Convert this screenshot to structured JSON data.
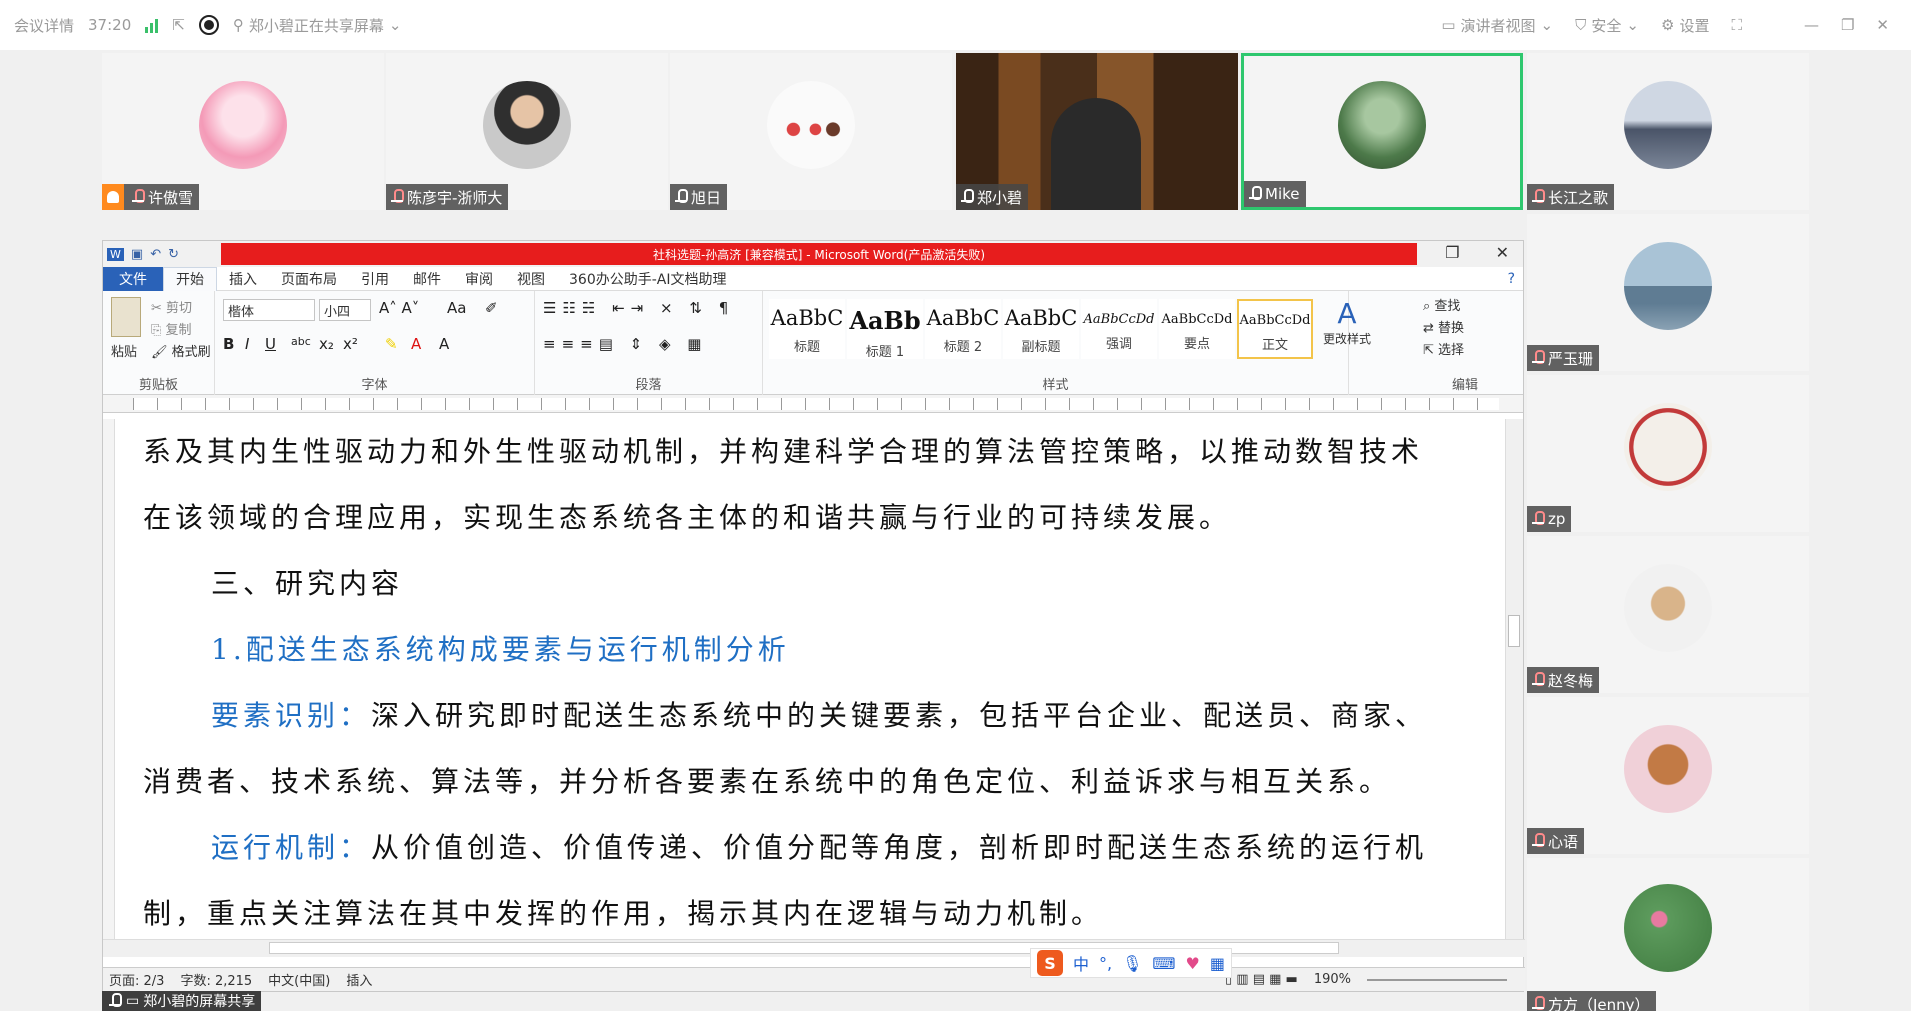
{
  "topbar": {
    "meeting_details": "会议详情",
    "timer": "37:20",
    "sharing_notice": "郑小碧正在共享屏幕",
    "presenter_view": "演讲者视图",
    "security": "安全",
    "settings": "设置"
  },
  "participants_top": [
    {
      "name": "许傲雪",
      "avatar_color": "#f7b7c8"
    },
    {
      "name": "陈彦宇-浙师大",
      "avatar_color": "#3b3b3b"
    },
    {
      "name": "旭日",
      "avatar_color": "#f5e2d8"
    },
    {
      "name": "郑小碧",
      "avatar_color": "#6b4a2a"
    },
    {
      "name": "Mike",
      "avatar_color": "#4d7a4a"
    }
  ],
  "participants_side": [
    {
      "name": "长江之歌",
      "avatar_color": "#7e8aa0"
    },
    {
      "name": "严玉珊",
      "avatar_color": "#9db6c9"
    },
    {
      "name": "zp",
      "avatar_color": "#e4e0dc"
    },
    {
      "name": "赵冬梅",
      "avatar_color": "#d9d6cf"
    },
    {
      "name": "心语",
      "avatar_color": "#d79868"
    },
    {
      "name": "方方（Jenny）",
      "avatar_color": "#6aa06a"
    }
  ],
  "word": {
    "title": "社科选题-孙高济 [兼容模式] - Microsoft Word(产品激活失败)",
    "tabs": [
      "文件",
      "开始",
      "插入",
      "页面布局",
      "引用",
      "邮件",
      "审阅",
      "视图",
      "360办公助手-AI文档助理"
    ],
    "clipboard": {
      "paste": "粘贴",
      "cut": "剪切",
      "copy": "复制",
      "format_painter": "格式刷",
      "label": "剪贴板"
    },
    "font": {
      "name": "楷体",
      "size": "小四",
      "label": "字体"
    },
    "paragraph_label": "段落",
    "styles": [
      {
        "sample": "AaBbC",
        "name": "标题"
      },
      {
        "sample": "AaBb",
        "name": "标题 1"
      },
      {
        "sample": "AaBbC",
        "name": "标题 2"
      },
      {
        "sample": "AaBbC",
        "name": "副标题"
      },
      {
        "sample": "AaBbCcDd",
        "name": "强调"
      },
      {
        "sample": "AaBbCcDd",
        "name": "要点"
      },
      {
        "sample": "AaBbCcDd",
        "name": "正文"
      }
    ],
    "styles_label": "样式",
    "change_styles": "更改样式",
    "editing": {
      "find": "查找",
      "replace": "替换",
      "select": "选择",
      "label": "编辑"
    },
    "document": {
      "line1": "系及其内生性驱动力和外生性驱动机制，并构建科学合理的算法管控策略，以推动数智技术",
      "line2": "在该领域的合理应用，实现生态系统各主体的和谐共赢与行业的可持续发展。",
      "heading3": "三、研究内容",
      "heading_sub": "1.配送生态系统构成要素与运行机制分析",
      "p1_label": "要素识别：",
      "p1_text": "深入研究即时配送生态系统中的关键要素，包括平台企业、配送员、商家、",
      "p1_cont": "消费者、技术系统、算法等，并分析各要素在系统中的角色定位、利益诉求与相互关系。",
      "p2_label": "运行机制：",
      "p2_text": "从价值创造、价值传递、价值分配等角度，剖析即时配送生态系统的运行机",
      "p2_cont": "制，重点关注算法在其中发挥的作用，揭示其内在逻辑与动力机制。"
    },
    "status": {
      "page": "页面: 2/3",
      "words": "字数: 2,215",
      "lang": "中文(中国)",
      "insert": "插入",
      "zoom": "190%"
    }
  },
  "ime": {
    "logo": "S",
    "mode": "中"
  },
  "share_label": "郑小碧的屏幕共享"
}
